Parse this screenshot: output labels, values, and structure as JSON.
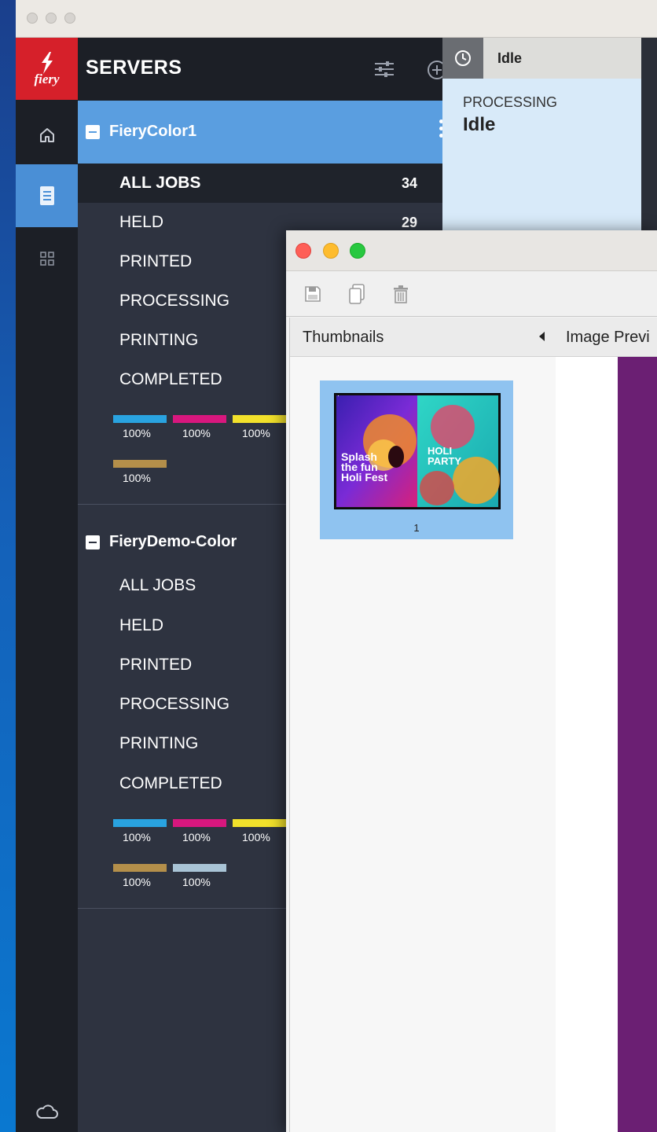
{
  "app": {
    "brand": "fiery"
  },
  "servers_panel": {
    "title": "SERVERS",
    "servers": [
      {
        "name": "FieryColor1",
        "categories": [
          {
            "label": "ALL JOBS",
            "count": "34"
          },
          {
            "label": "HELD",
            "count": "29"
          },
          {
            "label": "PRINTED",
            "count": ""
          },
          {
            "label": "PROCESSING",
            "count": ""
          },
          {
            "label": "PRINTING",
            "count": ""
          },
          {
            "label": "COMPLETED",
            "count": ""
          }
        ],
        "inks": [
          {
            "color": "#29a3e0",
            "level": "100%"
          },
          {
            "color": "#d8177e",
            "level": "100%"
          },
          {
            "color": "#f2e12b",
            "level": "100%"
          },
          {
            "color": "#b48f4a",
            "level": "100%"
          }
        ]
      },
      {
        "name": "FieryDemo-Color",
        "categories": [
          {
            "label": "ALL JOBS"
          },
          {
            "label": "HELD"
          },
          {
            "label": "PRINTED"
          },
          {
            "label": "PROCESSING"
          },
          {
            "label": "PRINTING"
          },
          {
            "label": "COMPLETED"
          }
        ],
        "inks": [
          {
            "color": "#29a3e0",
            "level": "100%"
          },
          {
            "color": "#d8177e",
            "level": "100%"
          },
          {
            "color": "#f2e12b",
            "level": "100%"
          },
          {
            "color": "#b48f4a",
            "level": "100%"
          },
          {
            "color": "#a9c4d6",
            "level": "100%"
          }
        ]
      }
    ]
  },
  "status": {
    "tab_label": "Idle",
    "section_label": "PROCESSING",
    "state": "Idle"
  },
  "preview_window": {
    "thumbnails_label": "Thumbnails",
    "image_preview_label": "Image Previ",
    "thumbnail": {
      "page_number": "1",
      "left_text": "Splash the fun Holi Fest",
      "right_text": "HOLI PARTY"
    }
  },
  "colors": {
    "accent": "#5a9ee0",
    "brand_red": "#d6202a",
    "preview_purple": "#6b1f73"
  }
}
